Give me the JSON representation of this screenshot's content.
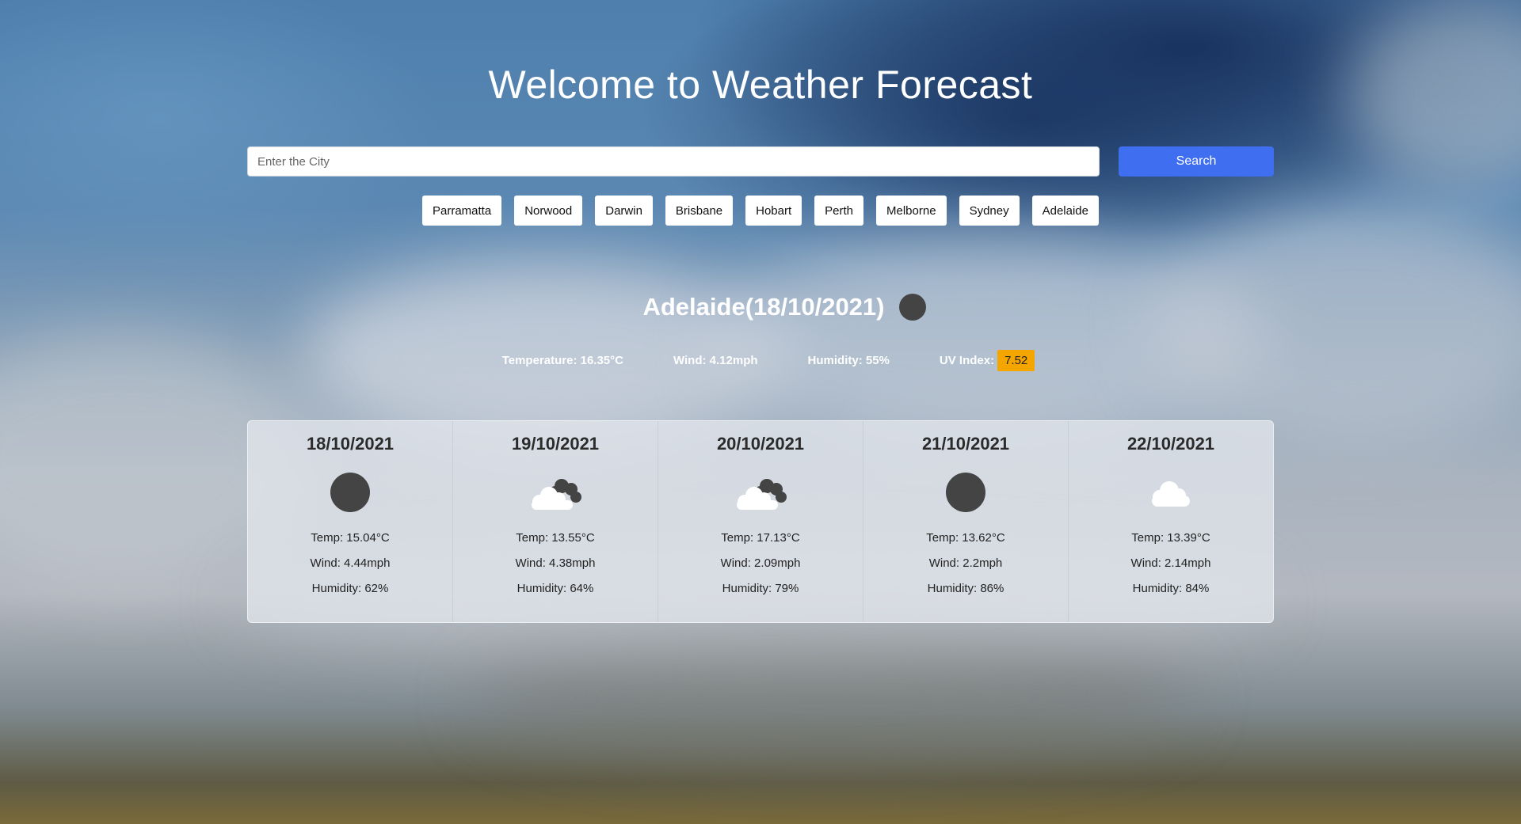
{
  "header": {
    "title": "Welcome to Weather Forecast"
  },
  "search": {
    "placeholder": "Enter the City",
    "value": "",
    "button_label": "Search"
  },
  "quick_cities": [
    "Parramatta",
    "Norwood",
    "Darwin",
    "Brisbane",
    "Hobart",
    "Perth",
    "Melborne",
    "Sydney",
    "Adelaide"
  ],
  "current": {
    "heading": "Adelaide(18/10/2021)",
    "icon": "dark-circle-icon",
    "temperature": "Temperature: 16.35°C",
    "wind": "Wind: 4.12mph",
    "humidity": "Humidity: 55%",
    "uv_label": "UV Index:",
    "uv_value": "7.52",
    "uv_color": "#f5a500"
  },
  "forecast": [
    {
      "date": "18/10/2021",
      "icon": "dark-circle-icon",
      "temp": "Temp: 15.04°C",
      "wind": "Wind: 4.44mph",
      "humidity": "Humidity: 62%"
    },
    {
      "date": "19/10/2021",
      "icon": "broken-clouds-icon",
      "temp": "Temp: 13.55°C",
      "wind": "Wind: 4.38mph",
      "humidity": "Humidity: 64%"
    },
    {
      "date": "20/10/2021",
      "icon": "broken-clouds-icon",
      "temp": "Temp: 17.13°C",
      "wind": "Wind: 2.09mph",
      "humidity": "Humidity: 79%"
    },
    {
      "date": "21/10/2021",
      "icon": "dark-circle-icon",
      "temp": "Temp: 13.62°C",
      "wind": "Wind: 2.2mph",
      "humidity": "Humidity: 86%"
    },
    {
      "date": "22/10/2021",
      "icon": "cloud-icon",
      "temp": "Temp: 13.39°C",
      "wind": "Wind: 2.14mph",
      "humidity": "Humidity: 84%"
    }
  ],
  "colors": {
    "search_button": "#3f6ff0",
    "uv_badge": "#f5a500",
    "icon_dark": "#444444"
  }
}
